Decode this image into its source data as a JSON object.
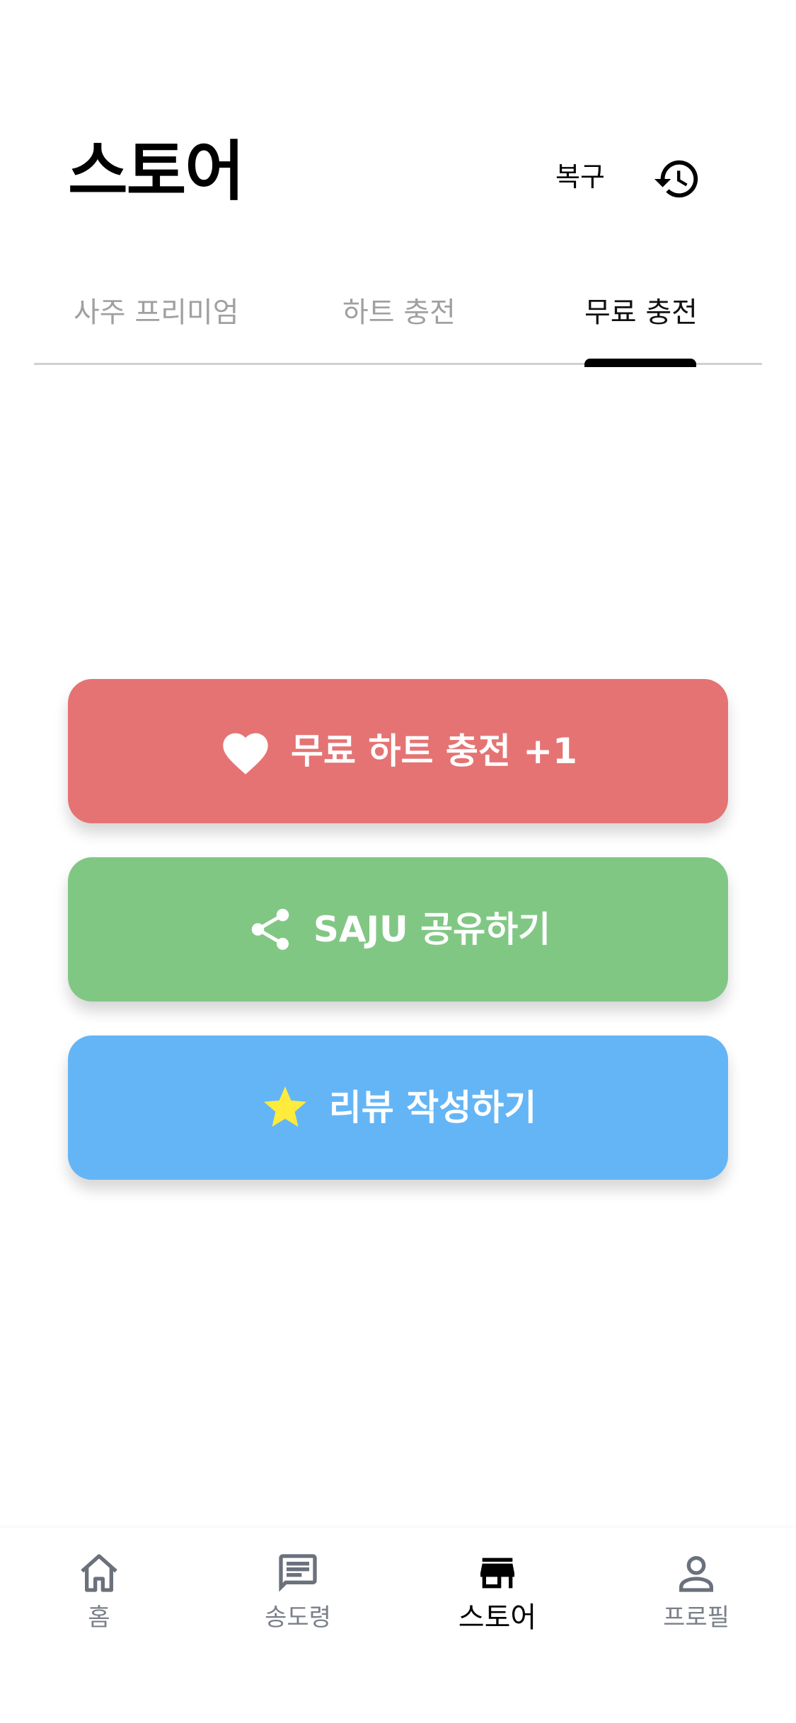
{
  "header": {
    "title": "스토어",
    "restore_label": "복구",
    "history_icon": "history-icon"
  },
  "tabs": [
    {
      "label": "사주 프리미엄",
      "active": false
    },
    {
      "label": "하트 충전",
      "active": false
    },
    {
      "label": "무료 충전",
      "active": true
    }
  ],
  "actions": [
    {
      "label": "무료 하트 충전 +1",
      "icon": "heart-icon",
      "color": "#E57373"
    },
    {
      "label": "SAJU 공유하기",
      "icon": "share-icon",
      "color": "#81C784"
    },
    {
      "label": "리뷰 작성하기",
      "icon": "star-icon",
      "color": "#64B5F6",
      "icon_color": "#FFEB3B"
    }
  ],
  "bottom_nav": [
    {
      "label": "홈",
      "icon": "home-icon",
      "active": false
    },
    {
      "label": "송도령",
      "icon": "chat-icon",
      "active": false
    },
    {
      "label": "스토어",
      "icon": "store-icon",
      "active": true
    },
    {
      "label": "프로필",
      "icon": "profile-icon",
      "active": false
    }
  ]
}
